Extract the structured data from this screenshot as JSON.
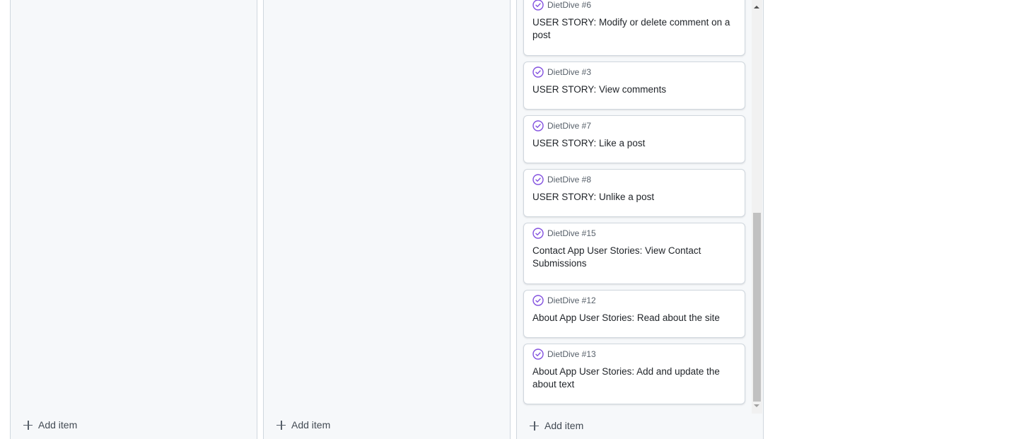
{
  "columns": [
    {
      "add_label": "Add item"
    },
    {
      "add_label": "Add item"
    },
    {
      "add_label": "Add item",
      "cards": [
        {
          "repo": "DietDive #6",
          "title": "USER STORY: Modify or delete comment on a post"
        },
        {
          "repo": "DietDive #3",
          "title": "USER STORY: View comments"
        },
        {
          "repo": "DietDive #7",
          "title": "USER STORY: Like a post"
        },
        {
          "repo": "DietDive #8",
          "title": "USER STORY: Unlike a post"
        },
        {
          "repo": "DietDive #15",
          "title": "Contact App User Stories: View Contact Submissions"
        },
        {
          "repo": "DietDive #12",
          "title": "About App User Stories: Read about the site"
        },
        {
          "repo": "DietDive #13",
          "title": "About App User Stories: Add and update the about text"
        }
      ]
    }
  ],
  "icons": {
    "card_status": "issue-closed-icon",
    "add": "plus-icon"
  },
  "colors": {
    "issue_closed": "#8250df",
    "column_bg": "#f6f8fa",
    "border": "#d0d7de"
  }
}
